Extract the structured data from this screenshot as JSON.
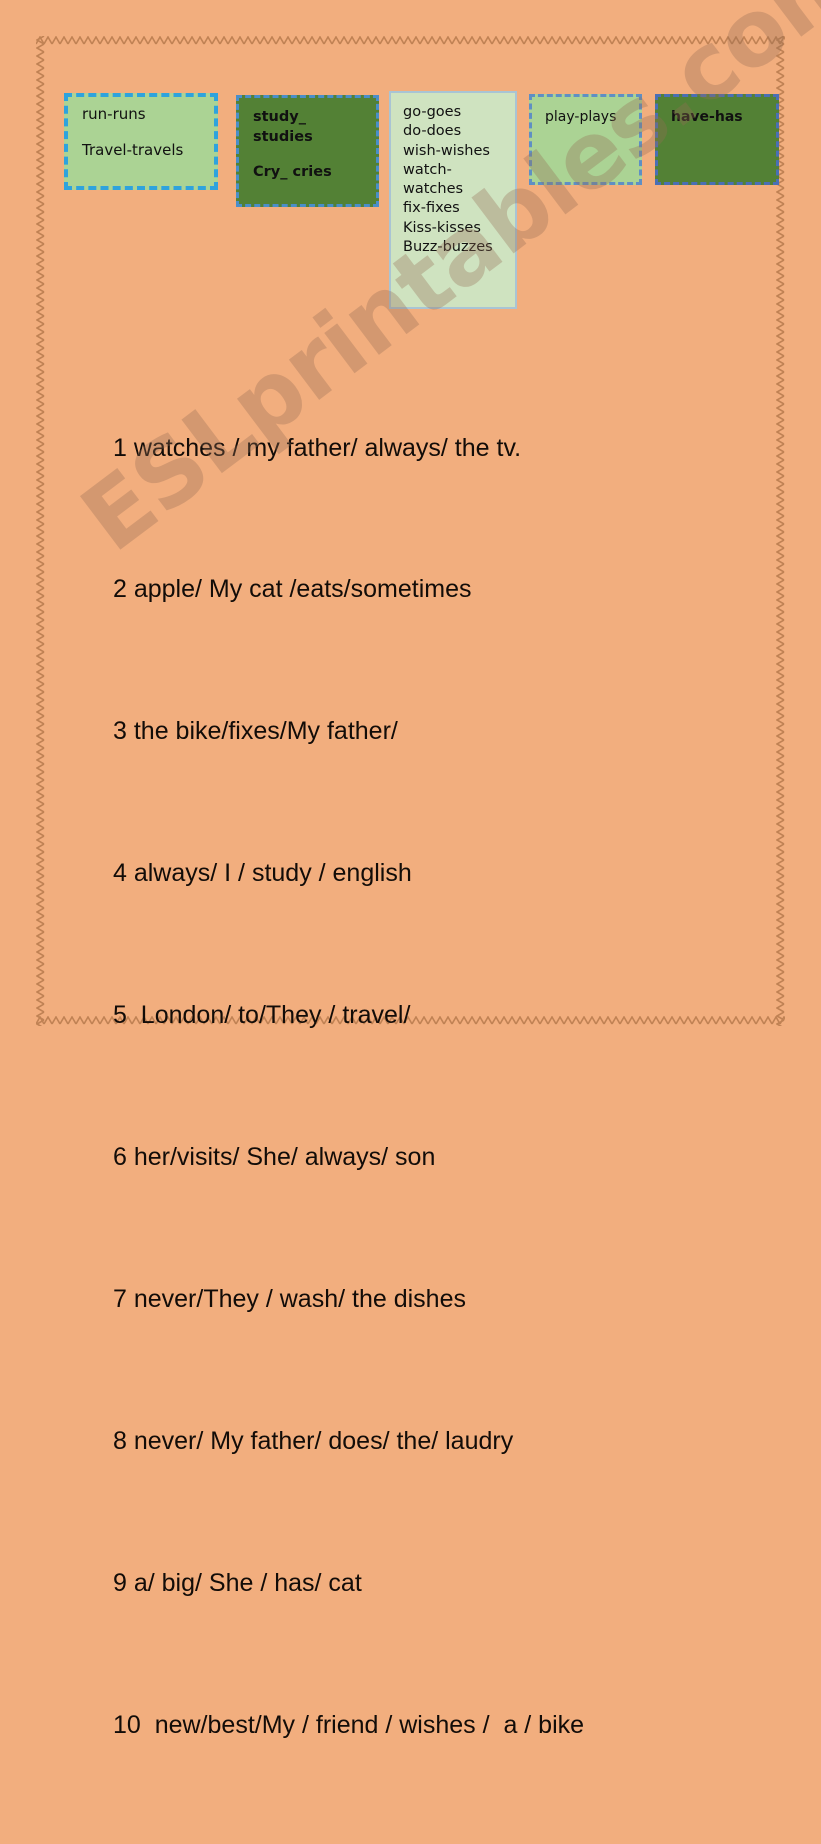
{
  "page": {
    "background_color": "#f2ae7e",
    "border_style": "zigzag-decorative-frame",
    "border_color": "#c98a5e"
  },
  "watermark": {
    "text": "ESLprintables.com",
    "color": "#96705530"
  },
  "vocab_boxes": [
    {
      "id": "box-run",
      "fill_color": "#abd394",
      "border_color": "#2ea3dd",
      "border_style": "dashed",
      "bold": false,
      "lines": [
        "run-runs",
        "Travel-travels"
      ]
    },
    {
      "id": "box-study",
      "fill_color": "#538135",
      "border_color": "#4a8ec9",
      "border_style": "dashed",
      "bold": true,
      "lines": [
        "study_",
        "studies",
        "Cry_ cries"
      ]
    },
    {
      "id": "box-list",
      "fill_color": "#cfe3c0",
      "border_color": "#a9c4d4",
      "border_style": "solid",
      "bold": false,
      "lines": [
        "go-goes",
        "do-does",
        "wish-wishes",
        "watch-",
        "watches",
        "fix-fixes",
        "Kiss-kisses",
        "Buzz-buzzes"
      ]
    },
    {
      "id": "box-play",
      "fill_color": "#abd394",
      "border_color": "#5f8fc4",
      "border_style": "dashed",
      "bold": false,
      "lines": [
        "play-plays"
      ]
    },
    {
      "id": "box-have",
      "fill_color": "#538135",
      "border_color": "#4a6fb5",
      "border_style": "dashed",
      "bold": true,
      "lines": [
        "have-has"
      ]
    }
  ],
  "sentences": [
    "1 watches / my father/ always/ the tv.",
    "2 apple/ My cat /eats/sometimes",
    "3 the bike/fixes/My father/",
    "4 always/ I / study / english",
    "5  London/ to/They / travel/",
    "6 her/visits/ She/ always/ son",
    "7 never/They / wash/ the dishes",
    "8 never/ My father/ does/ the/ laudry",
    "9 a/ big/ She / has/ cat",
    "10  new/best/My / friend / wishes /  a / bike"
  ]
}
